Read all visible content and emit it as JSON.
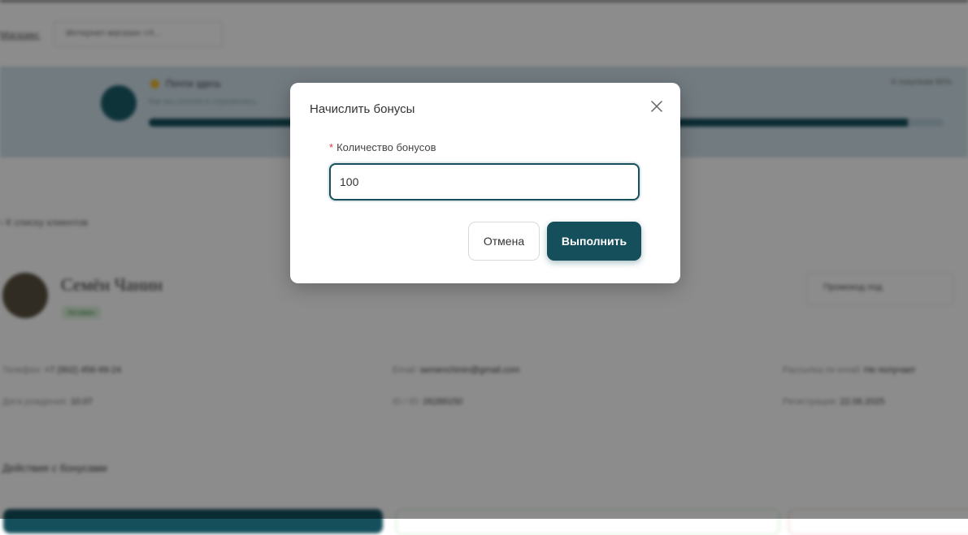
{
  "background": {
    "store_label": "Магазин:",
    "store_select_value": "Интернет-магазин «Х...",
    "loyalty_level": {
      "title": "Почти здесь",
      "subtitle": "Как мы хотели и стремились",
      "right_text": "К покупкам 80%",
      "progress": 0.955
    },
    "back_link": "К списку клиентов",
    "client": {
      "name": "Семён Чанин",
      "status_badge": "Активен",
      "promo_button": "Промокод под"
    },
    "info": {
      "phone_label": "Телефон:",
      "phone_value": "+7 (902) 456-99-24",
      "birthdate_label": "Дата рождения:",
      "birthdate_value": "10.07",
      "email_label": "Email:",
      "email_value": "semenchinin@gmail.com",
      "id_label": "ID / ID:",
      "id_value": "26289150",
      "mailing_label": "Рассылка по email:",
      "mailing_value": "Не получает",
      "registration_label": "Регистрация:",
      "registration_value": "22.06.2025"
    },
    "section_title": "Действия с бонусами"
  },
  "modal": {
    "title": "Начислить бонусы",
    "field_label": "Количество бонусов",
    "required_mark": "*",
    "input_value": "100",
    "cancel_label": "Отмена",
    "submit_label": "Выполнить"
  },
  "colors": {
    "primary": "#154f5c",
    "required": "#e0393e"
  }
}
